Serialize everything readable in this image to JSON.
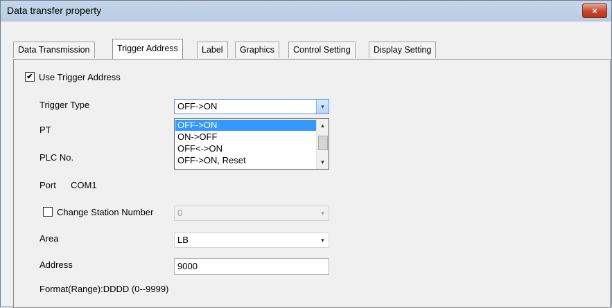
{
  "window": {
    "title": "Data transfer property",
    "close_label": "×"
  },
  "tabs": [
    {
      "label": "Data Transmission"
    },
    {
      "label": "Trigger Address"
    },
    {
      "label": "Label"
    },
    {
      "label": "Graphics"
    },
    {
      "label": "Control Setting"
    },
    {
      "label": "Display Setting"
    }
  ],
  "form": {
    "use_trigger": {
      "label": "Use Trigger Address",
      "checked": true,
      "check_glyph": "✔"
    },
    "trigger_type": {
      "label": "Trigger Type",
      "value": "OFF->ON",
      "options": [
        "OFF->ON",
        "ON->OFF",
        "OFF<->ON",
        "OFF->ON, Reset"
      ]
    },
    "pt_label": "PT",
    "plc_no_label": "PLC No.",
    "port": {
      "label": "Port",
      "value": "COM1"
    },
    "change_station": {
      "label": "Change Station Number",
      "checked": false,
      "value": "0"
    },
    "area": {
      "label": "Area",
      "value": "LB"
    },
    "address": {
      "label": "Address",
      "value": "9000"
    },
    "format_text": "Format(Range):DDDD (0--9999)"
  },
  "icons": {
    "dropdown": "▾",
    "scroll_up": "▲",
    "scroll_down": "▼"
  },
  "colors": {
    "selection": "#3399ff",
    "close_button": "#c7452b",
    "titlebar": "#bfd1e8"
  }
}
